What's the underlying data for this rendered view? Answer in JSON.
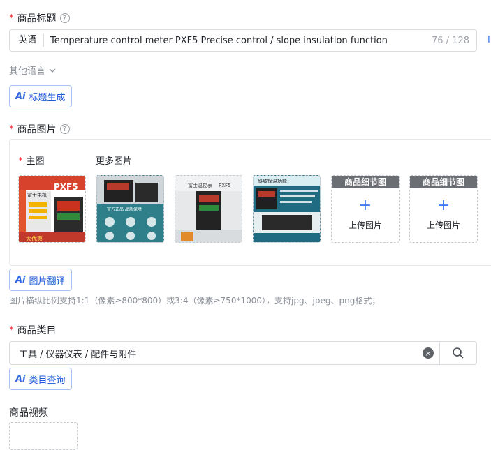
{
  "title_section": {
    "label": "商品标题",
    "help": "?",
    "language": "英语",
    "value": "Temperature control meter PXF5 Precise  control / slope insulation function",
    "count": "76 / 128",
    "other_languages": "其他语言",
    "ai_button": "标题生成"
  },
  "ai_mark": "Ai",
  "images_section": {
    "label": "商品图片",
    "help": "?",
    "main_label": "主图",
    "more_label": "更多图片",
    "upload_slots": [
      {
        "header": "商品细节图",
        "text": "上传图片",
        "plus": "+"
      },
      {
        "header": "商品细节图",
        "text": "上传图片",
        "plus": "+"
      }
    ],
    "ai_button": "图片翻译",
    "hint": "图片横纵比例支持1:1（像素≥800*800）或3:4（像素≥750*1000），支持jpg、jpeg、png格式；",
    "thumbs": [
      {
        "t1": "富士电机",
        "t2": "PXF5",
        "t3": "大优惠"
      },
      {
        "t1": "官方正品 品质保障"
      },
      {
        "t1": "富士温控表",
        "t2": "PXF5"
      },
      {
        "t1": "斜坡保温功能"
      }
    ]
  },
  "category_section": {
    "label": "商品类目",
    "value": "工具 / 仪器仪表 / 配件与附件",
    "clear": "×",
    "ai_button": "类目查询"
  },
  "video_section": {
    "label": "商品视频"
  },
  "side_glyph": "I",
  "colors": {
    "required": "#f5222d",
    "accent": "#3f7bf6",
    "border": "#d9dbe0"
  }
}
